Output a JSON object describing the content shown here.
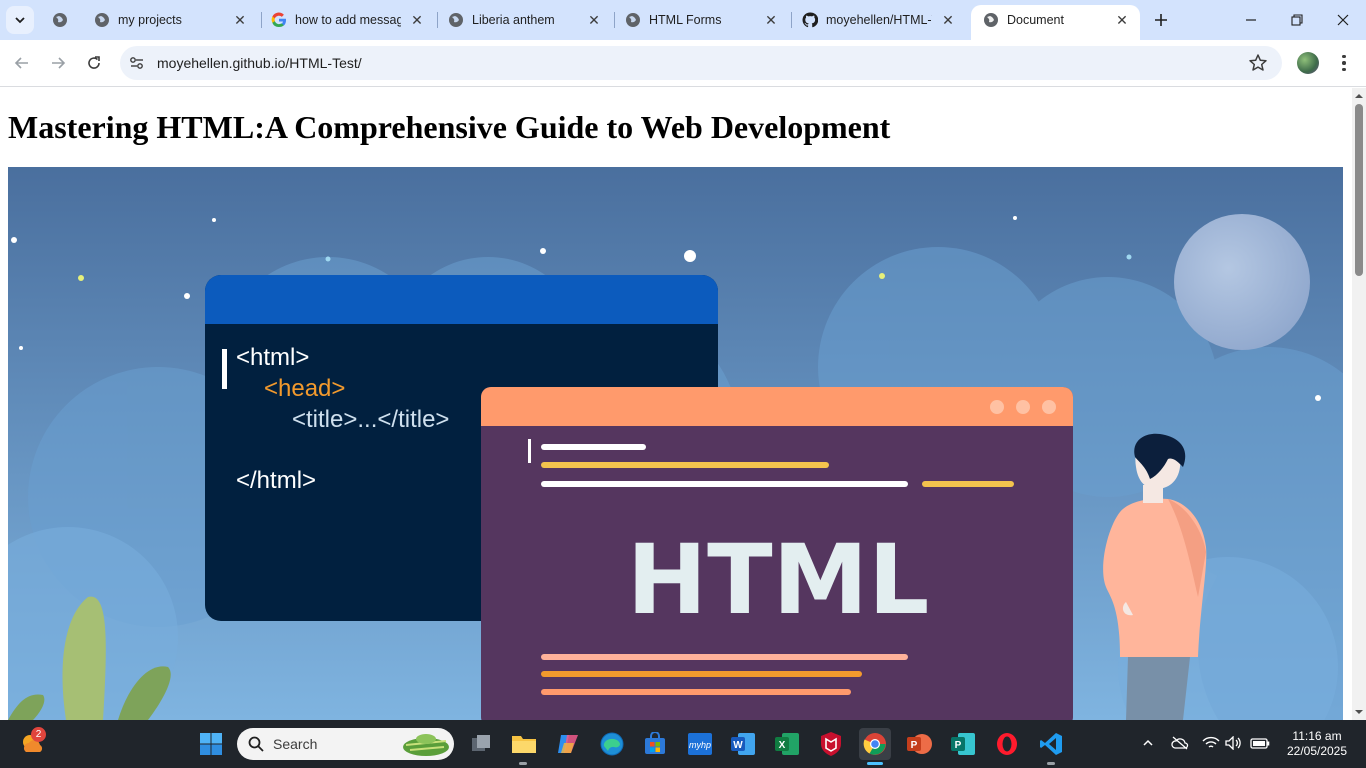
{
  "tabs": [
    {
      "label": "",
      "icon": "globe-icon"
    },
    {
      "label": "my projects",
      "icon": "globe-icon"
    },
    {
      "label": "how to add messag",
      "icon": "google-icon"
    },
    {
      "label": "Liberia anthem",
      "icon": "globe-icon"
    },
    {
      "label": "HTML Forms",
      "icon": "globe-icon"
    },
    {
      "label": "moyehellen/HTML-T",
      "icon": "github-icon"
    },
    {
      "label": "Document",
      "icon": "globe-icon",
      "active": true
    }
  ],
  "toolbar": {
    "url": "moyehellen.github.io/HTML-Test/"
  },
  "page": {
    "title": "Mastering HTML:A Comprehensive Guide to Web Development",
    "hero": {
      "code_lines": [
        "<html>",
        "<head>",
        "<title>...</title>",
        "</html>"
      ],
      "window_heading": "HTML",
      "colors": {
        "sky_top": "#4a6f9e",
        "sky_bottom": "#7fb4e0",
        "code_window": "#01203f",
        "code_header": "#0c5bbd",
        "html_window": "#55365f",
        "html_header": "#ff9a6c",
        "accent_yellow": "#f4c34d",
        "accent_orange": "#f39a2d"
      }
    }
  },
  "taskbar": {
    "search_label": "Search",
    "notification_count": "2",
    "time": "11:16 am",
    "date": "22/05/2025"
  }
}
